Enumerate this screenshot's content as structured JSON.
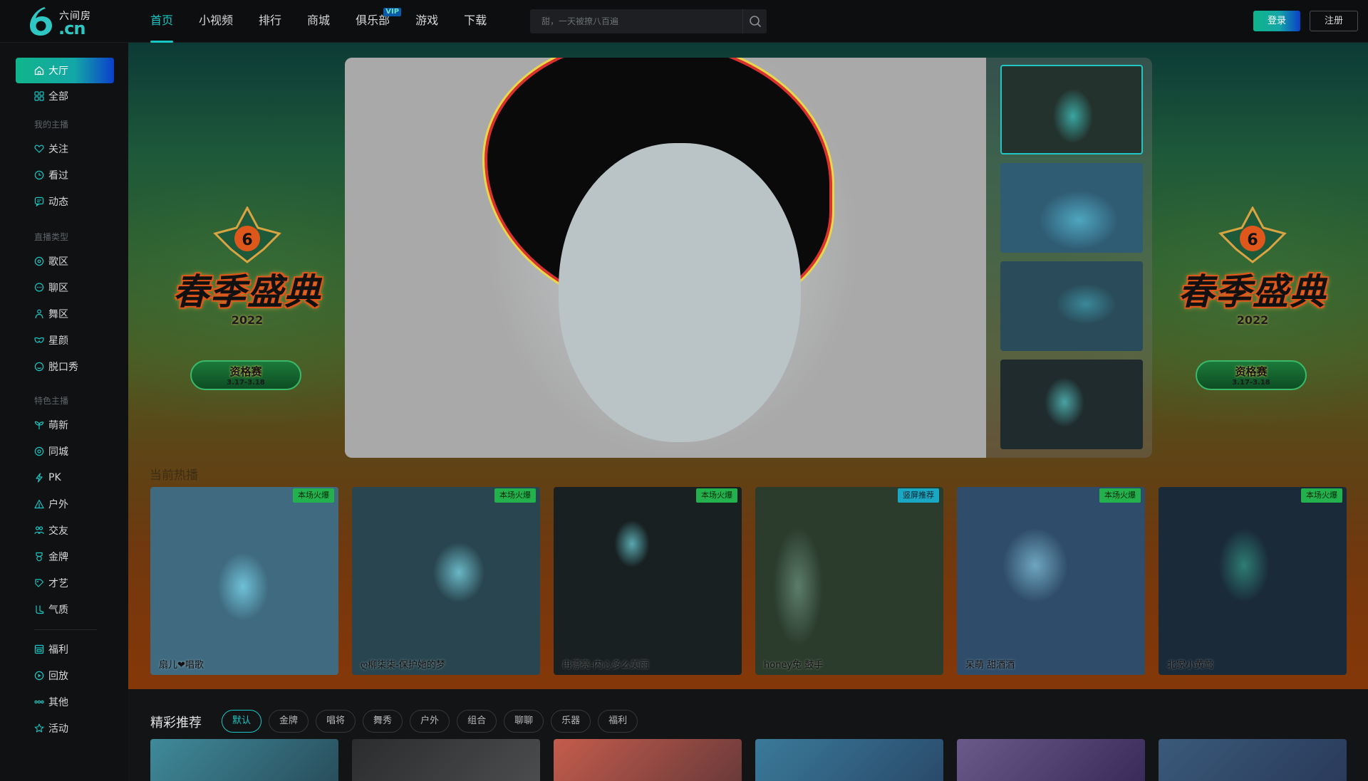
{
  "header": {
    "logo_top": "六间房",
    "logo_bottom": ".cn",
    "nav": [
      {
        "label": "首页",
        "active": true
      },
      {
        "label": "小视频"
      },
      {
        "label": "排行"
      },
      {
        "label": "商城"
      },
      {
        "label": "俱乐部",
        "badge": "VIP"
      },
      {
        "label": "游戏"
      },
      {
        "label": "下载"
      }
    ],
    "search_placeholder": "甜，一天被撩八百遍",
    "login": "登录",
    "register": "注册"
  },
  "sidebar": {
    "items_top": [
      {
        "label": "大厅",
        "icon": "home-icon",
        "active": true
      },
      {
        "label": "全部",
        "icon": "grid-icon"
      }
    ],
    "section_my": "我的主播",
    "items_my": [
      {
        "label": "关注",
        "icon": "heart-icon"
      },
      {
        "label": "看过",
        "icon": "clock-icon"
      },
      {
        "label": "动态",
        "icon": "message-icon"
      }
    ],
    "section_type": "直播类型",
    "items_type": [
      {
        "label": "歌区",
        "icon": "music-icon"
      },
      {
        "label": "聊区",
        "icon": "chat-icon"
      },
      {
        "label": "舞区",
        "icon": "dancer-icon"
      },
      {
        "label": "星颜",
        "icon": "mask-icon"
      },
      {
        "label": "脱口秀",
        "icon": "talk-icon"
      }
    ],
    "section_feature": "特色主播",
    "items_feature": [
      {
        "label": "萌新",
        "icon": "sprout-icon"
      },
      {
        "label": "同城",
        "icon": "location-icon"
      },
      {
        "label": "PK",
        "icon": "lightning-icon"
      },
      {
        "label": "户外",
        "icon": "tent-icon"
      },
      {
        "label": "交友",
        "icon": "users-icon"
      },
      {
        "label": "金牌",
        "icon": "medal-icon"
      },
      {
        "label": "才艺",
        "icon": "palette-icon"
      },
      {
        "label": "气质",
        "icon": "boot-icon"
      }
    ],
    "items_bottom": [
      {
        "label": "福利",
        "icon": "gift-icon"
      },
      {
        "label": "回放",
        "icon": "replay-icon"
      },
      {
        "label": "其他",
        "icon": "dots-icon"
      },
      {
        "label": "活动",
        "icon": "star-icon"
      }
    ]
  },
  "hero": {
    "event_title": "春季盛典",
    "event_year": "2022",
    "event_pill": "资格赛",
    "event_dates": "3.17-3.18",
    "section_hot": "当前热播",
    "cards": [
      {
        "name": "扇儿❤唱歌",
        "tag": "本场火爆",
        "tag_color": "#22b14c"
      },
      {
        "name": "ღ柳柒柒-保护她的梦",
        "tag": "本场火爆",
        "tag_color": "#22b14c"
      },
      {
        "name": "冉漂亮-内心多么美丽",
        "tag": "本场火爆",
        "tag_color": "#22b14c"
      },
      {
        "name": "honey兔 鼓手",
        "tag": "竖屏推荐",
        "tag_color": "#1aa7c4"
      },
      {
        "name": "呆萌 甜酒酒",
        "tag": "本场火爆",
        "tag_color": "#22b14c"
      },
      {
        "name": "北家小黄莺",
        "tag": "本场火爆",
        "tag_color": "#22b14c"
      }
    ]
  },
  "recommend": {
    "title": "精彩推荐",
    "chips": [
      "默认",
      "金牌",
      "唱将",
      "舞秀",
      "户外",
      "组合",
      "聊聊",
      "乐器",
      "福利"
    ]
  }
}
